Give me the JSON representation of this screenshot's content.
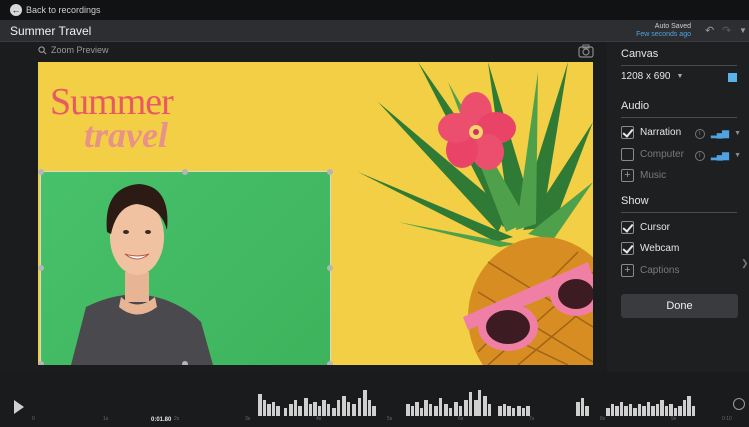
{
  "topbar": {
    "back_label": "Back to recordings"
  },
  "titlebar": {
    "title": "Summer Travel",
    "autosave_status": "Auto Saved",
    "autosave_time": "Few seconds ago"
  },
  "preview": {
    "zoom_label": "Zoom Preview",
    "canvas_title_1": "Summer",
    "canvas_title_2": "travel"
  },
  "panel": {
    "canvas": {
      "title": "Canvas",
      "size": "1208 x 690",
      "color": "#5ab2ea"
    },
    "audio": {
      "title": "Audio",
      "narration": {
        "label": "Narration",
        "checked": true
      },
      "computer": {
        "label": "Computer",
        "checked": false
      },
      "music": {
        "label": "Music"
      }
    },
    "show": {
      "title": "Show",
      "cursor": {
        "label": "Cursor",
        "checked": true
      },
      "webcam": {
        "label": "Webcam",
        "checked": true
      },
      "captions": {
        "label": "Captions"
      }
    },
    "done_label": "Done"
  },
  "timeline": {
    "playhead_time": "0:01.80",
    "ticks": [
      "0",
      "1s",
      "2s",
      "3s",
      "4s",
      "5s",
      "6s",
      "7s",
      "8s",
      "9s",
      "0:10"
    ]
  },
  "colors": {
    "accent": "#4fa3e0",
    "canvas_bg": "#f2cf45",
    "webcam_bg": "#47c16a"
  }
}
